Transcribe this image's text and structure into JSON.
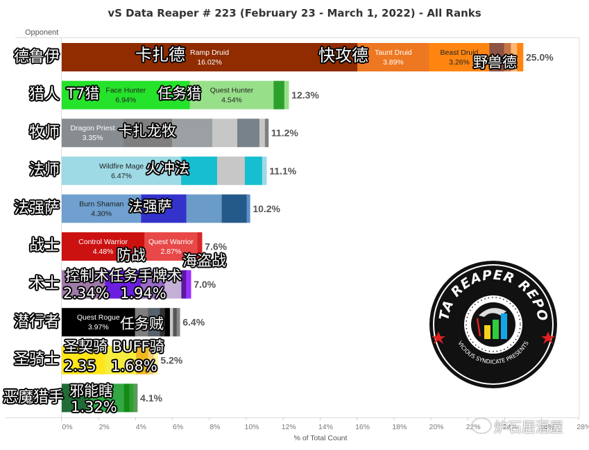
{
  "chart_data": {
    "type": "bar",
    "orientation": "horizontal-stacked",
    "title": "vS Data Reaper # 223 (February 23 - March 1, 2022) - All Ranks",
    "ylabel": "Opponent",
    "xlabel": "% of Total Count",
    "xlim": [
      0,
      28
    ],
    "xticks": [
      "0%",
      "2%",
      "4%",
      "6%",
      "8%",
      "10%",
      "12%",
      "14%",
      "16%",
      "18%",
      "20%",
      "22%",
      "24%",
      "26%",
      "28%"
    ],
    "grid": false,
    "categories": [
      "德鲁伊",
      "猎人",
      "牧师",
      "法师",
      "法强萨",
      "战士",
      "术士",
      "潜行者",
      "圣骑士",
      "恶魔猎手"
    ],
    "totals": [
      "25.0%",
      "12.3%",
      "11.2%",
      "11.1%",
      "10.2%",
      "7.6%",
      "7.0%",
      "6.4%",
      "5.2%",
      "4.1%"
    ],
    "rows": [
      {
        "segments": [
          {
            "value": 16.02,
            "color": "#902c00",
            "name": "Ramp Druid",
            "label": "16.02%",
            "textColor": "#fff"
          },
          {
            "value": 3.89,
            "color": "#ee7722",
            "name": "Taunt Druid",
            "label": "3.89%",
            "textColor": "#fff"
          },
          {
            "value": 3.26,
            "color": "#ff8510",
            "name": "Beast Druid",
            "label": "3.26%",
            "textColor": "#222"
          },
          {
            "value": 0.8,
            "color": "#8c5244"
          },
          {
            "value": 0.37,
            "color": "#c87545"
          },
          {
            "value": 0.33,
            "color": "#ffb574"
          },
          {
            "value": 0.33,
            "color": "#ff8510"
          }
        ]
      },
      {
        "segments": [
          {
            "value": 6.94,
            "color": "#25e22a",
            "name": "Face Hunter",
            "label": "6.94%",
            "textColor": "#222"
          },
          {
            "value": 4.54,
            "color": "#98df8a",
            "name": "Quest Hunter",
            "label": "4.54%",
            "textColor": "#222"
          },
          {
            "value": 0.58,
            "color": "#2ca02c"
          },
          {
            "value": 0.24,
            "color": "#98df8a"
          }
        ]
      },
      {
        "segments": [
          {
            "value": 3.35,
            "color": "#868c90",
            "name": "Dragon Priest",
            "label": "3.35%",
            "textColor": "#fff"
          },
          {
            "value": 2.63,
            "color": "#7f7f7f"
          },
          {
            "value": 2.18,
            "color": "#9ba0a2"
          },
          {
            "value": 1.35,
            "color": "#c7c7c7"
          },
          {
            "value": 1.2,
            "color": "#77828a"
          },
          {
            "value": 0.3,
            "color": "#c7c7c7"
          },
          {
            "value": 0.19,
            "color": "#7f7f7f"
          }
        ]
      },
      {
        "segments": [
          {
            "value": 6.47,
            "color": "#9edae5",
            "name": "Wildfire Mage",
            "label": "6.47%",
            "textColor": "#222"
          },
          {
            "value": 1.95,
            "color": "#17becf"
          },
          {
            "value": 1.5,
            "color": "#c7c7c7"
          },
          {
            "value": 0.94,
            "color": "#17becf"
          },
          {
            "value": 0.24,
            "color": "#9edae5"
          }
        ]
      },
      {
        "segments": [
          {
            "value": 4.3,
            "color": "#6fa0cf",
            "name": "Burn Shaman",
            "label": "4.30%",
            "textColor": "#222"
          },
          {
            "value": 2.45,
            "color": "#3333cc"
          },
          {
            "value": 1.92,
            "color": "#6b9bc8"
          },
          {
            "value": 1.35,
            "color": "#245a8a"
          },
          {
            "value": 0.18,
            "color": "#5b8fc8"
          }
        ]
      },
      {
        "segments": [
          {
            "value": 4.48,
            "color": "#cc1111",
            "name": "Control Warrior",
            "label": "4.48%",
            "textColor": "#fff"
          },
          {
            "value": 2.87,
            "color": "#e84848",
            "name": "Quest Warrior",
            "label": "2.87%",
            "textColor": "#fff"
          },
          {
            "value": 0.25,
            "color": "#d62728"
          }
        ]
      },
      {
        "segments": [
          {
            "value": 2.34,
            "color": "#a07aa8"
          },
          {
            "value": 1.94,
            "color": "#6a1ee0"
          },
          {
            "value": 1.3,
            "color": "#9a6ac8"
          },
          {
            "value": 0.9,
            "color": "#c5b0d5"
          },
          {
            "value": 0.26,
            "color": "#5a1aa0"
          },
          {
            "value": 0.26,
            "color": "#9b30ff"
          }
        ]
      },
      {
        "segments": [
          {
            "value": 3.97,
            "color": "#000000",
            "name": "Quest Rogue",
            "label": "3.97%",
            "textColor": "#fff"
          },
          {
            "value": 0.7,
            "color": "#7f7f7f"
          },
          {
            "value": 0.65,
            "color": "#56616b"
          },
          {
            "value": 0.27,
            "color": "#303030"
          },
          {
            "value": 0.27,
            "color": "#000000"
          },
          {
            "value": 0.17,
            "color": "#c7c7c7"
          },
          {
            "value": 0.2,
            "color": "#555555"
          },
          {
            "value": 0.17,
            "color": "#888888"
          }
        ]
      },
      {
        "segments": [
          {
            "value": 2.35,
            "color": "#ffe51a"
          },
          {
            "value": 1.68,
            "color": "#f5ec40"
          },
          {
            "value": 0.65,
            "color": "#f0b820"
          },
          {
            "value": 0.3,
            "color": "#f5d070"
          },
          {
            "value": 0.22,
            "color": "#fff3a0"
          }
        ]
      },
      {
        "segments": [
          {
            "value": 1.32,
            "color": "#216c36"
          },
          {
            "value": 2.05,
            "color": "#33a845"
          },
          {
            "value": 0.3,
            "color": "#168a16"
          },
          {
            "value": 0.2,
            "color": "#2ca02c"
          },
          {
            "value": 0.23,
            "color": "#5a9a5a"
          }
        ]
      }
    ]
  },
  "annotations": {
    "ramp": "卡扎德",
    "taunt": "快攻德",
    "beast": "野兽德",
    "face": "T7猎",
    "questhunter": "任务猎",
    "dragon": "卡扎龙牧",
    "wildfire": "火冲法",
    "burn": "法强萨",
    "control": "防战",
    "pirate": "海盗战",
    "warlock": "控制术任务手牌术",
    "warlock_a": "2.34%",
    "warlock_b": "1.94%",
    "rogue": "任务贼",
    "paladin": "圣契骑 BUFF骑",
    "paladin_a": "2.35",
    "paladin_b": "1.68%",
    "dh": "邪能瞎",
    "dh_a": "1.32%"
  },
  "logo": {
    "top": "DATA REAPER REPORT",
    "bottom": "VICIOUS SYNDICATE PRESENTS"
  },
  "watermark": "炉石居酒屋"
}
